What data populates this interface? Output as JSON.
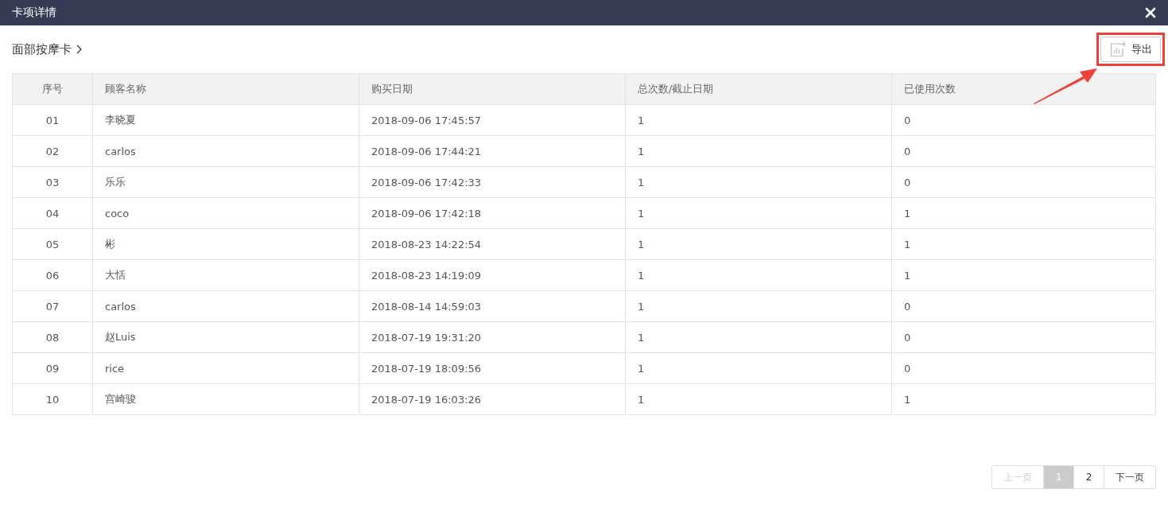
{
  "window": {
    "title": "卡项详情"
  },
  "breadcrumb": {
    "label": "面部按摩卡"
  },
  "toolbar": {
    "export_button": "导出"
  },
  "table": {
    "columns": [
      "序号",
      "顾客名称",
      "购买日期",
      "总次数/截止日期",
      "已使用次数"
    ],
    "rows": [
      [
        "01",
        "李晓夏",
        "2018-09-06 17:45:57",
        "1",
        "0"
      ],
      [
        "02",
        "carlos",
        "2018-09-06 17:44:21",
        "1",
        "0"
      ],
      [
        "03",
        "乐乐",
        "2018-09-06 17:42:33",
        "1",
        "0"
      ],
      [
        "04",
        "coco",
        "2018-09-06 17:42:18",
        "1",
        "1"
      ],
      [
        "05",
        "彬",
        "2018-08-23 14:22:54",
        "1",
        "1"
      ],
      [
        "06",
        "大恬",
        "2018-08-23 14:19:09",
        "1",
        "1"
      ],
      [
        "07",
        "carlos",
        "2018-08-14 14:59:03",
        "1",
        "0"
      ],
      [
        "08",
        "赵Luis",
        "2018-07-19 19:31:20",
        "1",
        "0"
      ],
      [
        "09",
        "rice",
        "2018-07-19 18:09:56",
        "1",
        "0"
      ],
      [
        "10",
        "宫崎骏",
        "2018-07-19 16:03:26",
        "1",
        "1"
      ]
    ]
  },
  "pagination": {
    "prev": {
      "label": "上一页",
      "disabled": true
    },
    "pages": [
      {
        "label": "1",
        "selected": true
      },
      {
        "label": "2",
        "selected": false
      }
    ],
    "next": {
      "label": "下一页",
      "disabled": false
    }
  }
}
